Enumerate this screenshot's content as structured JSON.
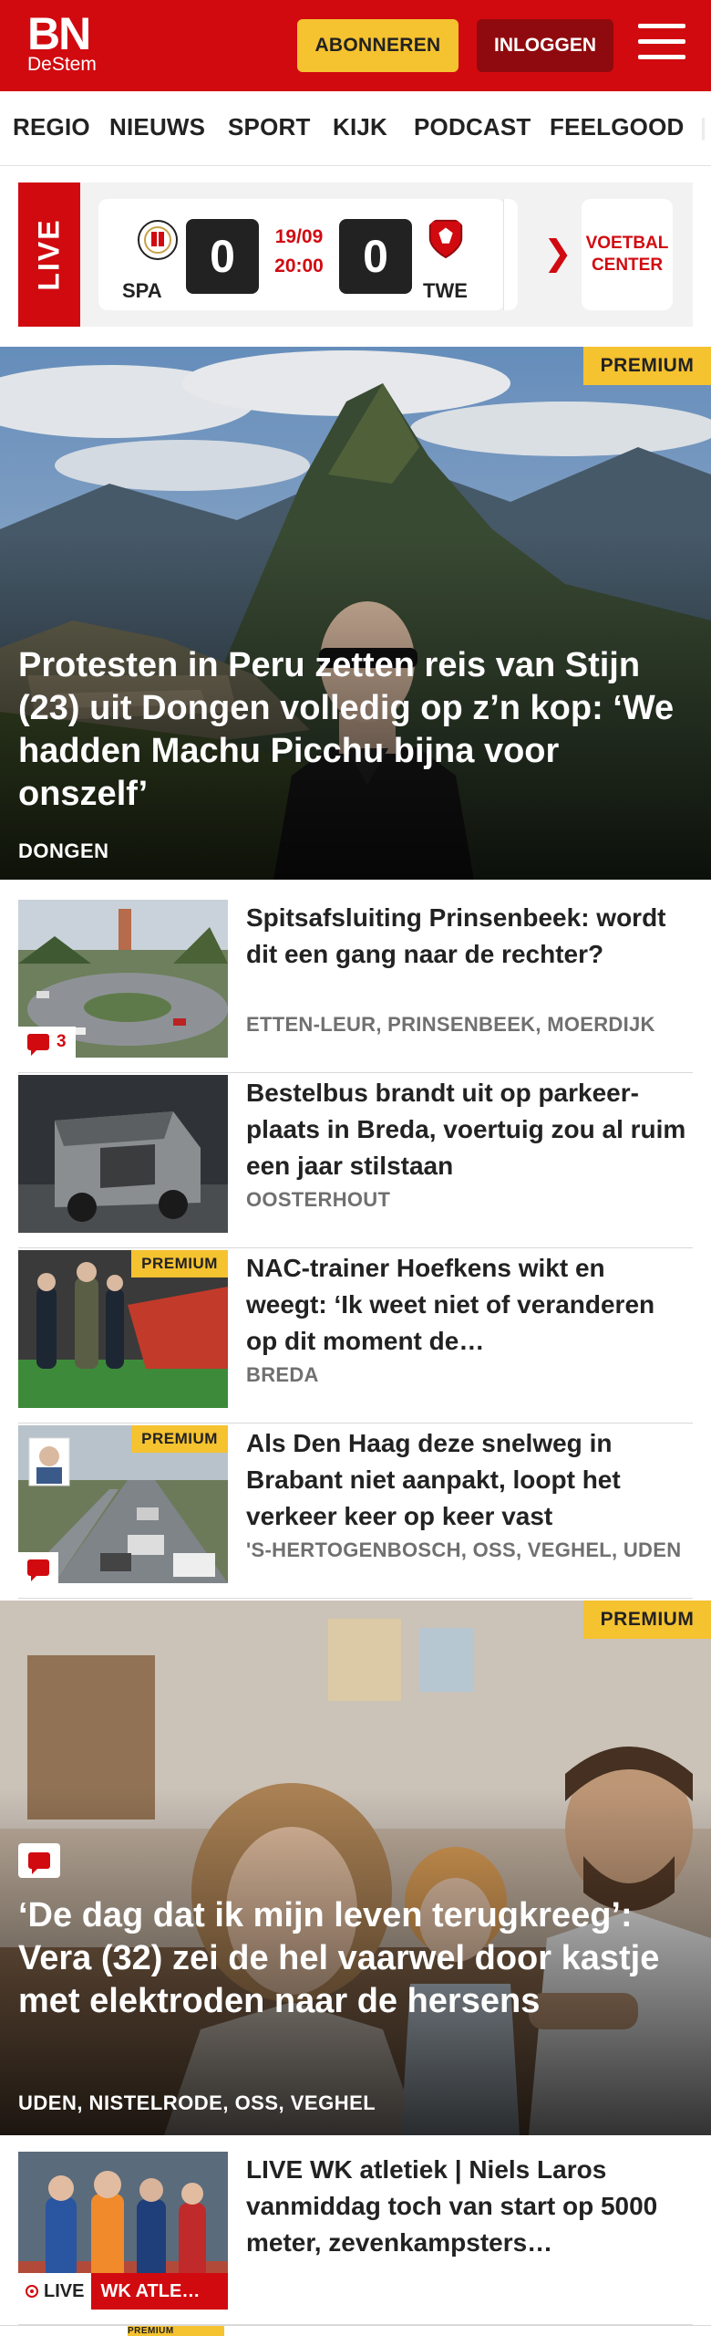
{
  "header": {
    "logo_main": "BN",
    "logo_sub": "DeStem",
    "subscribe_label": "ABONNEREN",
    "login_label": "INLOGGEN",
    "brand_color": "#d10a10"
  },
  "nav": {
    "items": [
      "REGIO",
      "NIEUWS",
      "SPORT",
      "KIJK",
      "PODCAST",
      "FEELGOOD"
    ]
  },
  "live": {
    "tag": "LIVE",
    "home_team": "SPA",
    "away_team": "TWE",
    "home_score": "0",
    "away_score": "0",
    "date": "19/09",
    "time": "20:00",
    "center_label_1": "VOETBAL",
    "center_label_2": "CENTER"
  },
  "hero1": {
    "badge": "PREMIUM",
    "title": "Protesten in Peru zetten reis van Stijn (23) uit Dongen volledig op z’n kop: ‘We hadden Machu Picchu bijna voor onszelf’",
    "category": "DONGEN"
  },
  "articles": [
    {
      "title": "Spitsafsluiting Prinsenbeek: wordt dit een gang naar de rechter?",
      "category": "ETTEN-LEUR, PRINSENBEEK, MOERDIJK",
      "comments": "3"
    },
    {
      "title": "Bestelbus brandt uit op parkeer­plaats in Breda, voertuig zou al ruim een jaar stilstaan",
      "category": "OOSTERHOUT"
    },
    {
      "title": "NAC-trainer Hoefkens wikt en weegt: ‘Ik weet niet of veranderen op dit moment de…",
      "category": "BREDA",
      "badge": "PREMIUM"
    },
    {
      "title": "Als Den Haag deze snelweg in Brabant niet aanpakt, loopt het verkeer keer op keer vast",
      "category": "'S-HERTOGENBOSCH, OSS, VEGHEL, UDEN",
      "badge": "PREMIUM"
    }
  ],
  "hero2": {
    "badge": "PREMIUM",
    "title": "‘De dag dat ik mijn leven terugkreeg’: Vera (32) zei de hel vaarwel door kastje met elektroden naar de hersens",
    "category": "UDEN, NISTELRODE, OSS, VEGHEL"
  },
  "article_live": {
    "title": "LIVE WK atletiek | Niels Laros vanmiddag toch van start op 5000 meter, zevenkampsters…",
    "live_label": "LIVE",
    "tag": "WK ATLE…"
  },
  "bottom_badge": "PREMIUM"
}
